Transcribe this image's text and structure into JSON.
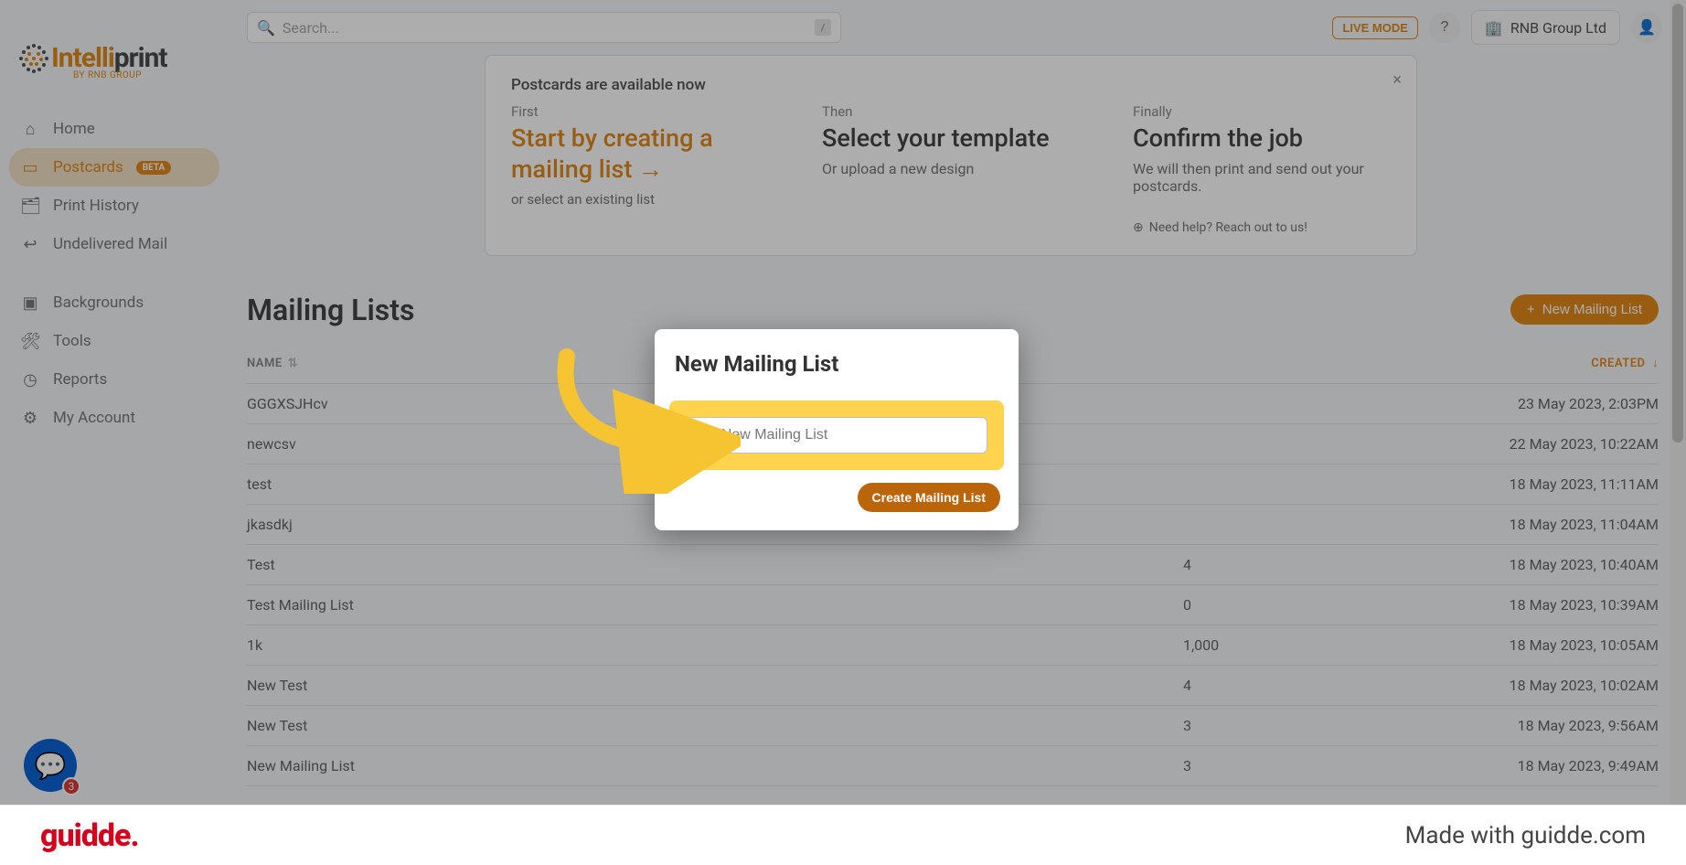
{
  "brand": {
    "name_part_highlight": "Intelli",
    "name_part_rest": "print",
    "subtitle": "BY RNB GROUP"
  },
  "topbar": {
    "search_placeholder": "Search...",
    "shortcut_hint": "/",
    "live_mode_label": "LIVE MODE",
    "company_name": "RNB Group Ltd"
  },
  "sidebar": {
    "items": [
      {
        "id": "home",
        "label": "Home",
        "icon": "⌂"
      },
      {
        "id": "postcards",
        "label": "Postcards",
        "icon": "▭",
        "badge": "BETA",
        "active": true
      },
      {
        "id": "print-history",
        "label": "Print History",
        "icon": "🗂"
      },
      {
        "id": "undelivered",
        "label": "Undelivered Mail",
        "icon": "↩"
      },
      {
        "id": "backgrounds",
        "label": "Backgrounds",
        "icon": "▣",
        "gap": true
      },
      {
        "id": "tools",
        "label": "Tools",
        "icon": "🛠"
      },
      {
        "id": "reports",
        "label": "Reports",
        "icon": "◷"
      },
      {
        "id": "account",
        "label": "My Account",
        "icon": "⚙"
      }
    ]
  },
  "banner": {
    "title": "Postcards are available now",
    "first_label": "First",
    "first_heading": "Start by creating a mailing list →",
    "first_sub": "or select an existing list",
    "then_label": "Then",
    "then_heading": "Select your template",
    "then_sub": "Or upload a new design",
    "finally_label": "Finally",
    "finally_heading": "Confirm the job",
    "finally_sub": "We will then print and send out your postcards.",
    "help_text": "Need help? Reach out to us!"
  },
  "mailing_lists": {
    "heading": "Mailing Lists",
    "new_button_label": "New Mailing List",
    "columns": {
      "name": "NAME",
      "recipients": "",
      "created": "CREATED"
    },
    "rows": [
      {
        "name": "GGGXSJHcv",
        "recipients": "",
        "created": "23 May 2023, 2:03PM"
      },
      {
        "name": "newcsv",
        "recipients": "",
        "created": "22 May 2023, 10:22AM"
      },
      {
        "name": "test",
        "recipients": "",
        "created": "18 May 2023, 11:11AM"
      },
      {
        "name": "jkasdkj",
        "recipients": "",
        "created": "18 May 2023, 11:04AM"
      },
      {
        "name": "Test",
        "recipients": "4",
        "created": "18 May 2023, 10:40AM"
      },
      {
        "name": "Test Mailing List",
        "recipients": "0",
        "created": "18 May 2023, 10:39AM"
      },
      {
        "name": "1k",
        "recipients": "1,000",
        "created": "18 May 2023, 10:05AM"
      },
      {
        "name": "New Test",
        "recipients": "4",
        "created": "18 May 2023, 10:02AM"
      },
      {
        "name": "New Test",
        "recipients": "3",
        "created": "18 May 2023, 9:56AM"
      },
      {
        "name": "New Mailing List",
        "recipients": "3",
        "created": "18 May 2023, 9:49AM"
      }
    ]
  },
  "modal": {
    "title": "New Mailing List",
    "input_placeholder": "My New Mailing List",
    "create_button_label": "Create Mailing List"
  },
  "help_bubble": {
    "badge_count": "3"
  },
  "footer": {
    "logo_text": "guidde.",
    "tagline": "Made with guidde.com"
  },
  "colors": {
    "orange": "#e28a1a",
    "orange_dark": "#ba6509",
    "highlight_yellow": "#ffd34d",
    "help_blue": "#0b63d6",
    "help_badge_red": "#d83a3a",
    "guidde_red": "#d6001c"
  }
}
